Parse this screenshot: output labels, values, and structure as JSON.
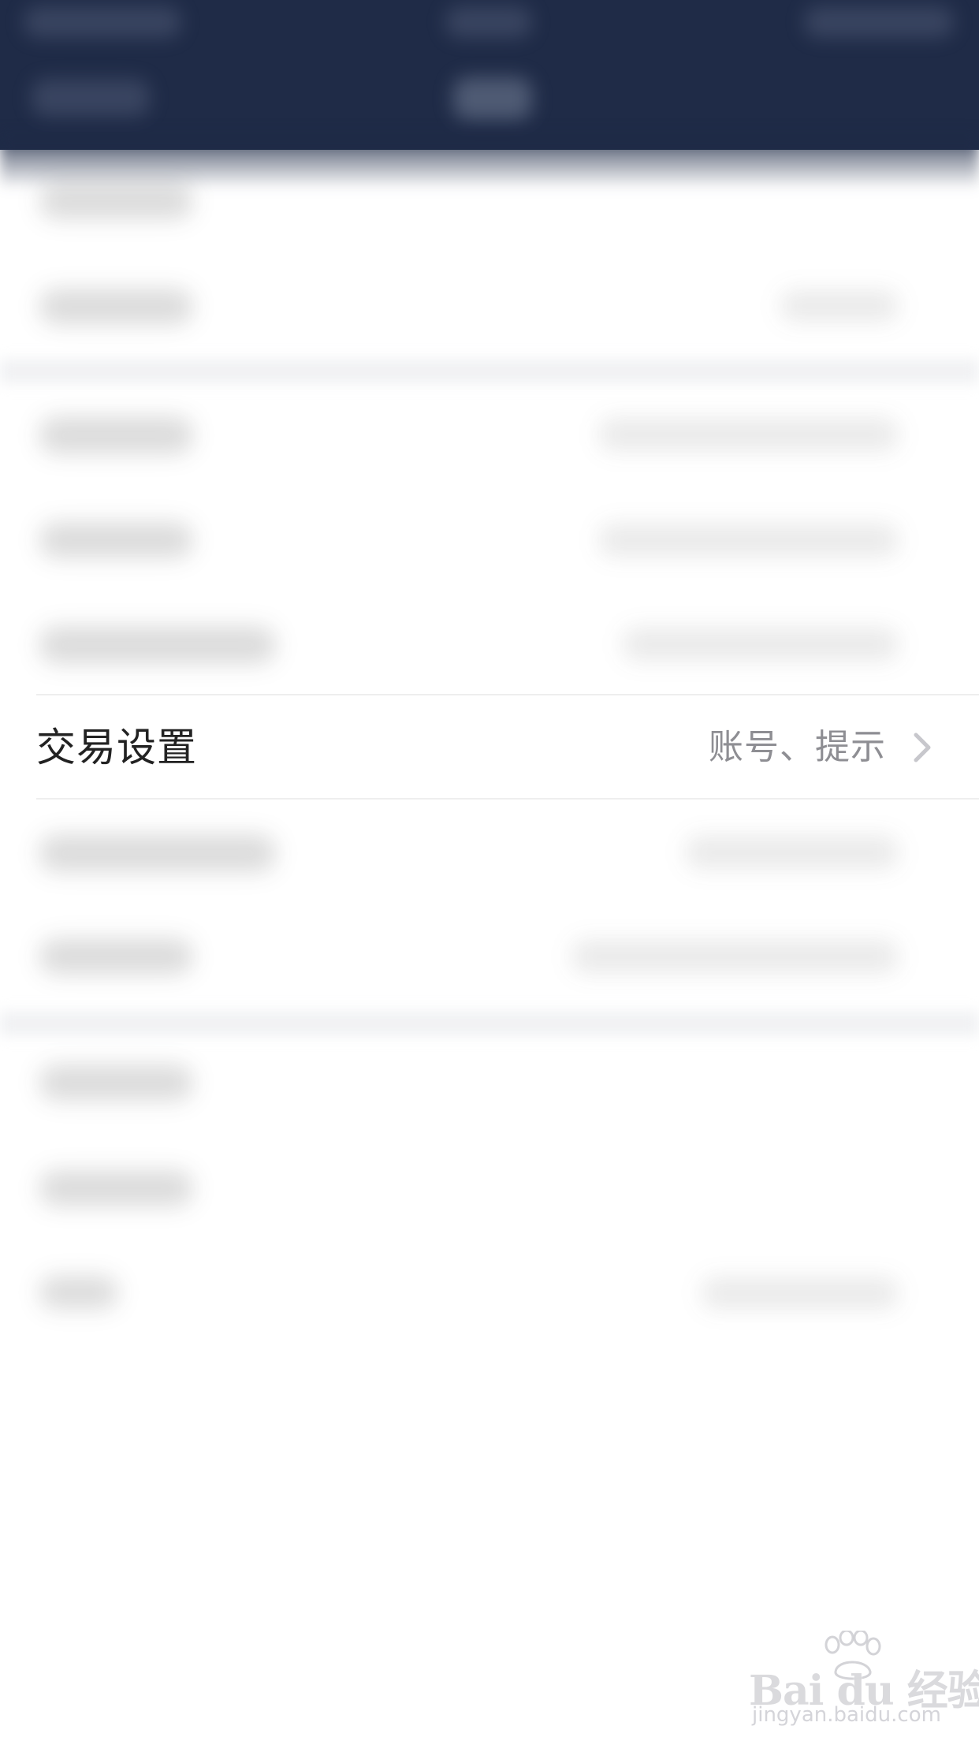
{
  "settings_row": {
    "label": "交易设置",
    "value": "账号、提示",
    "chevron_icon": "chevron-right-icon"
  },
  "watermark": {
    "brand": "Bai du 经验",
    "url": "jingyan.baidu.com",
    "icon": "paw-icon"
  },
  "colors": {
    "nav_background": "#1f2b47",
    "label_text": "#222222",
    "value_text": "#8e8e93",
    "chevron": "#c7c7cc",
    "divider": "#eeeeee"
  }
}
